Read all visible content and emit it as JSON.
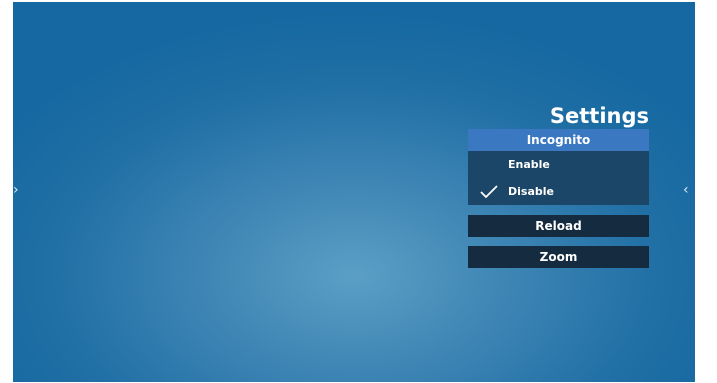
{
  "nav": {
    "left_arrow": "›",
    "right_arrow": "‹"
  },
  "settings": {
    "title": "Settings",
    "incognito": {
      "header": "Incognito",
      "options": [
        {
          "label": "Enable",
          "selected": false
        },
        {
          "label": "Disable",
          "selected": true
        }
      ]
    },
    "reload_label": "Reload",
    "zoom_label": "Zoom"
  },
  "colors": {
    "header_bg": "#3b78c2",
    "options_bg": "#1c4667",
    "button_bg": "#142b40",
    "background": "#206fa5"
  }
}
